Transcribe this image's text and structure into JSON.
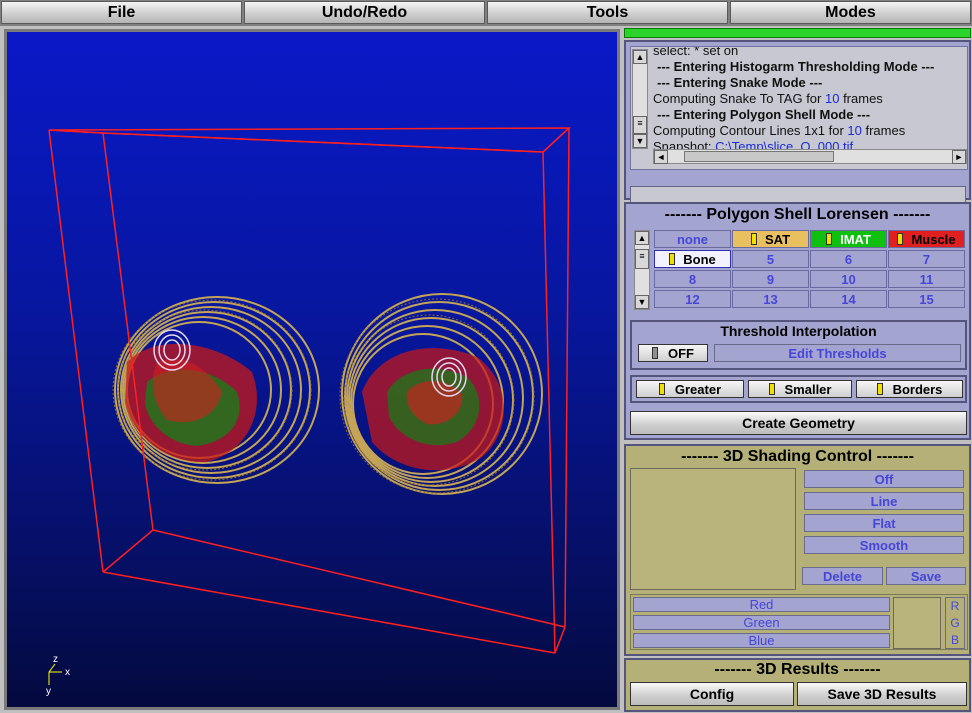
{
  "menu": {
    "file": "File",
    "undo_redo": "Undo/Redo",
    "tools": "Tools",
    "modes": "Modes"
  },
  "log": {
    "lines": [
      {
        "text": "select: * set on"
      },
      {
        "text": "--- Entering Histogarm Thresholding Mode ---"
      },
      {
        "text": "--- Entering Snake Mode ---"
      },
      {
        "pre": "Computing Snake To TAG for ",
        "val": "10",
        "post": " frames"
      },
      {
        "text": "--- Entering Polygon Shell Mode ---"
      },
      {
        "pre": "Computing Contour Lines 1x1 for ",
        "val": "10",
        "post": " frames"
      },
      {
        "pre": "Snapshot: ",
        "val": "C:\\Temp\\slice_O_000.tif"
      }
    ]
  },
  "polygon_shell": {
    "title": "------- Polygon Shell Lorensen -------",
    "tags": [
      "none",
      "SAT",
      "IMAT",
      "Muscle",
      "Bone",
      "5",
      "6",
      "7",
      "8",
      "9",
      "10",
      "11",
      "12",
      "13",
      "14",
      "15"
    ],
    "tag_colors": {
      "SAT": "#e8c060",
      "IMAT": "#10c010",
      "Muscle": "#e02020",
      "Bone": "#f2f2ff"
    }
  },
  "threshold": {
    "title": "Threshold Interpolation",
    "toggle_label": "OFF",
    "edit_label": "Edit Thresholds"
  },
  "filters": {
    "greater": "Greater",
    "smaller": "Smaller",
    "borders": "Borders"
  },
  "create_geometry": "Create Geometry",
  "shading": {
    "title": "------- 3D Shading Control -------",
    "modes": [
      "Off",
      "Line",
      "Flat",
      "Smooth"
    ],
    "delete": "Delete",
    "save": "Save",
    "channels": [
      "Red",
      "Green",
      "Blue"
    ],
    "rgb_letters": [
      "R",
      "G",
      "B"
    ]
  },
  "results": {
    "title": "------- 3D Results -------",
    "config": "Config",
    "save": "Save 3D Results"
  },
  "axes": {
    "x": "x",
    "y": "y",
    "z": "z"
  },
  "colors": {
    "accent": "#2ad42a",
    "background_top": "#0a18c8",
    "wireframe": "#ff2020"
  }
}
